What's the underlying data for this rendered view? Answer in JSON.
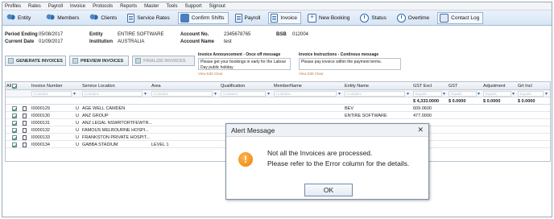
{
  "menu": [
    "Profiles",
    "Rates",
    "Payroll",
    "Invoice",
    "Protocols",
    "Reports",
    "Master",
    "Tools",
    "Support",
    "Signout"
  ],
  "toolbar": [
    {
      "label": "Entity",
      "icon": "people-icon"
    },
    {
      "label": "Members",
      "icon": "members-icon"
    },
    {
      "label": "Clients",
      "icon": "clients-icon"
    },
    {
      "label": "Service Rates",
      "icon": "rates-document-icon"
    },
    {
      "label": "Confirm Shifts",
      "icon": "confirm-shifts-icon"
    },
    {
      "label": "Payroll",
      "icon": "payroll-document-icon"
    },
    {
      "label": "Invoice",
      "icon": "invoice-document-icon"
    },
    {
      "label": "New Booking",
      "icon": "new-booking-icon"
    },
    {
      "label": "Status",
      "icon": "status-clock-icon"
    },
    {
      "label": "Overtime",
      "icon": "overtime-clock-icon"
    },
    {
      "label": "Contact Log",
      "icon": "contact-log-icon"
    }
  ],
  "info": {
    "period_ending_label": "Period Ending",
    "period_ending_value": "05/08/2017",
    "current_date_label": "Current Date",
    "current_date_value": "01/09/2017",
    "entity_label": "Entity",
    "entity_value": "ENTIRE SOFTWARE",
    "institution_label": "Institution",
    "institution_value": "AUSTRALIA",
    "account_no_label": "Account No.",
    "account_no_value": "2345678765",
    "account_name_label": "Account Name",
    "account_name_value": "test",
    "bsb_label": "BSB",
    "bsb_value": "012004"
  },
  "actions": {
    "generate": "GENERATE INVOICES",
    "preview": "PREVIEW INVOICES",
    "finalize": "FINALIZE INVOICES"
  },
  "announcement": {
    "title": "Invoice Announcement - Once off message",
    "text": "Please get your bookings in early for the Labour Day public holiday",
    "edit": "View Edit Clear"
  },
  "instructions": {
    "title": "Invoice Instructions - Continous message",
    "text": "Please pay invoice within the payment terms.",
    "edit": "View Edit Clear"
  },
  "grid": {
    "columns": [
      "All",
      "Invoice Number",
      "Service Location",
      "Area",
      "Qualification",
      "MemberName",
      "Entity Name",
      "GST Excl",
      "GST",
      "Adjustment",
      "Grt Incl"
    ],
    "filter_placeholder": "Contains",
    "filter_placeholder_num": "Equals",
    "summary": {
      "gst_excl": "$ 4,333.0000",
      "gst": "$ 0.0000",
      "adjustment": "$ 0.0000",
      "grt_incl": "$ 0.0000"
    },
    "rows": [
      {
        "invoice": "I0000129",
        "flag": "U",
        "service_location": "AGE WELL CAMDEN",
        "area": "",
        "entity": "BEV",
        "gst_excl": "609.0600"
      },
      {
        "invoice": "I0000130",
        "flag": "U",
        "service_location": "ANZ GROUP",
        "area": "",
        "entity": "ENTIRE SOFTWARE",
        "gst_excl": "477.0000"
      },
      {
        "invoice": "I0000131",
        "flag": "U",
        "service_location": "ANZ LEGAL NSWRTORTFEWTR...",
        "area": "",
        "entity": "",
        "gst_excl": ""
      },
      {
        "invoice": "I0000132",
        "flag": "U",
        "service_location": "FAMOUS MELBOURNE HOSPI...",
        "area": "",
        "entity": "",
        "gst_excl": ""
      },
      {
        "invoice": "I0000133",
        "flag": "U",
        "service_location": "FRANKSTON PRIVATE HOSPIT...",
        "area": "",
        "entity": "",
        "gst_excl": ""
      },
      {
        "invoice": "I0000134",
        "flag": "U",
        "service_location": "GABBA STADIUM",
        "area": "LEVEL 1",
        "entity": "",
        "gst_excl": ""
      }
    ]
  },
  "modal": {
    "title": "Alert Message",
    "icon": "warning-icon",
    "line1": "Not all the Invoices are processed.",
    "line2": "Please refer to the Error column for the details.",
    "ok": "OK"
  }
}
